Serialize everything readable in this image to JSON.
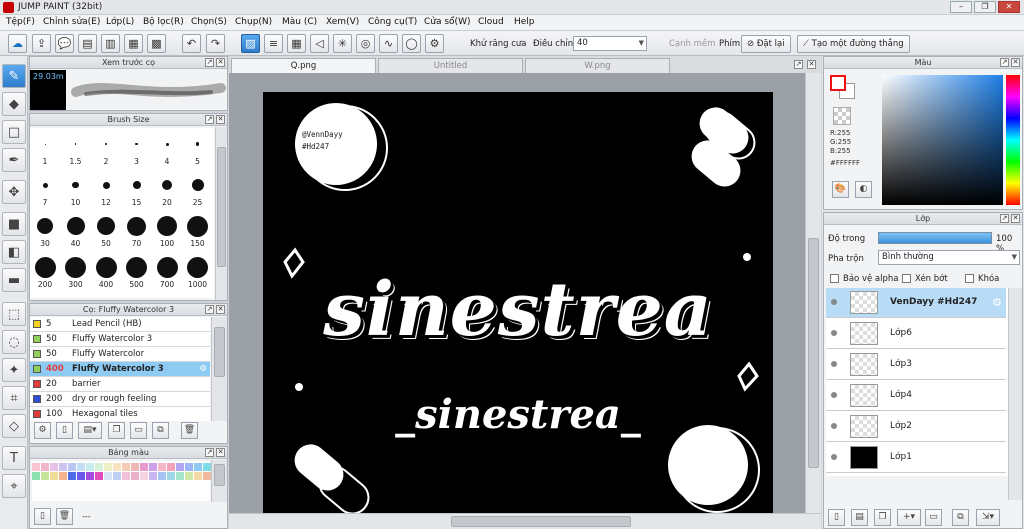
{
  "app": {
    "title": "JUMP PAINT (32bit)"
  },
  "window": {
    "minimize": "–",
    "maximize": "❐",
    "close": "✕"
  },
  "menu": [
    "Tệp(F)",
    "Chỉnh sửa(E)",
    "Lớp(L)",
    "Bộ lọc(R)",
    "Chọn(S)",
    "Chụp(N)",
    "Màu (C)",
    "Xem(V)",
    "Công cụ(T)",
    "Cửa sổ(W)",
    "Cloud",
    "Help"
  ],
  "toolbar": {
    "antialias_label": "Khử răng cưa",
    "adjust_label": "Điều chỉnh",
    "adjust_value": "40",
    "smooth_label": "Cạnh mềm",
    "key_label": "Phím",
    "reset_label": "Đặt lại",
    "straight_label": "Tạo một đường thẳng"
  },
  "preview": {
    "title": "Xem trước cọ",
    "size_text": "29.03m"
  },
  "brush_size": {
    "title": "Brush Size",
    "sizes": [
      "1",
      "1.5",
      "2",
      "3",
      "4",
      "5",
      "7",
      "10",
      "12",
      "15",
      "20",
      "25",
      "30",
      "40",
      "50",
      "70",
      "100",
      "150",
      "200",
      "300",
      "400",
      "500",
      "700",
      "1000"
    ]
  },
  "brush_list": {
    "title": "Cọ: Fluffy Watercolor 3",
    "items": [
      {
        "num": "5",
        "name": "Lead Pencil (HB)",
        "color": "#f2d21a"
      },
      {
        "num": "50",
        "name": "Fluffy Watercolor 3",
        "color": "#8fd15a"
      },
      {
        "num": "50",
        "name": "Fluffy Watercolor",
        "color": "#8fd15a"
      },
      {
        "num": "400",
        "name": "Fluffy Watercolor 3",
        "color": "#8fd15a"
      },
      {
        "num": "20",
        "name": "barrier",
        "color": "#e23b3b"
      },
      {
        "num": "200",
        "name": "dry or rough feeling",
        "color": "#2c4fd6"
      },
      {
        "num": "100",
        "name": "Hexagonal tiles",
        "color": "#e23b3b"
      }
    ]
  },
  "palette": {
    "title": "Bảng màu",
    "footer": "---"
  },
  "tabs": [
    {
      "label": "Q.png",
      "active": true
    },
    {
      "label": "Untitled",
      "active": false
    },
    {
      "label": "W.png",
      "active": false
    }
  ],
  "artwork": {
    "watermark_user": "@VennDayy",
    "watermark_tag": "#Hd247",
    "title": "sinestrea",
    "subtitle": "_sinestrea_"
  },
  "color_panel": {
    "title": "Màu",
    "r": "R:255",
    "g": "G:255",
    "b": "B:255",
    "hex": "#FFFFFF"
  },
  "layers": {
    "title": "Lớp",
    "opacity_label": "Độ trong",
    "opacity_value": "100 %",
    "opacity": 1.0,
    "blend_label": "Pha trộn",
    "blend_value": "Bình thường",
    "protect_alpha": "Bảo vệ alpha",
    "clipping": "Xén bớt",
    "lock": "Khóa",
    "items": [
      {
        "name": "VenDayy #Hd247",
        "selected": true,
        "fill": "check"
      },
      {
        "name": "Lớp6",
        "selected": false,
        "fill": "check"
      },
      {
        "name": "Lớp3",
        "selected": false,
        "fill": "check"
      },
      {
        "name": "Lớp4",
        "selected": false,
        "fill": "check"
      },
      {
        "name": "Lớp2",
        "selected": false,
        "fill": "check"
      },
      {
        "name": "Lớp1",
        "selected": false,
        "fill": "black"
      }
    ]
  }
}
